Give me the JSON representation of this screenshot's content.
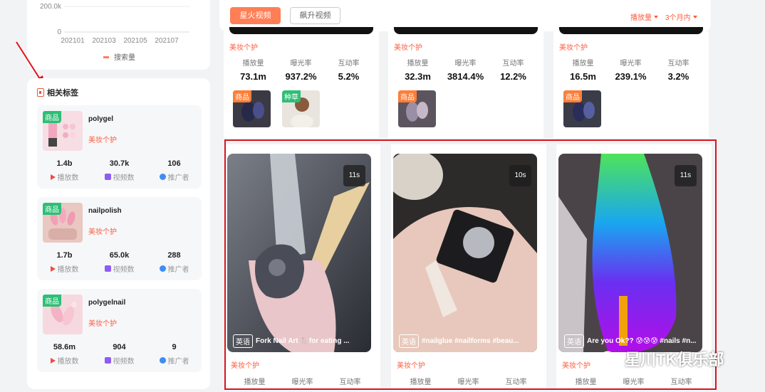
{
  "mini_chart": {
    "y_ticks": [
      "200.0k",
      "0"
    ],
    "x_ticks": [
      "202101",
      "202103",
      "202105",
      "202107"
    ],
    "legend": "搜索量",
    "line_color": "#ff7e55"
  },
  "related_tags": {
    "title": "相关标签",
    "items": [
      {
        "badge": "商品",
        "name": "polygel",
        "category": "美妆个护",
        "stats": [
          {
            "value": "1.4b",
            "label": "播放数"
          },
          {
            "value": "30.7k",
            "label": "视频数"
          },
          {
            "value": "106",
            "label": "推广者"
          }
        ]
      },
      {
        "badge": "商品",
        "name": "nailpolish",
        "category": "美妆个护",
        "stats": [
          {
            "value": "1.7b",
            "label": "播放数"
          },
          {
            "value": "65.0k",
            "label": "视频数"
          },
          {
            "value": "288",
            "label": "推广者"
          }
        ]
      },
      {
        "badge": "商品",
        "name": "polygelnail",
        "category": "美妆个护",
        "stats": [
          {
            "value": "58.6m",
            "label": "播放数"
          },
          {
            "value": "904",
            "label": "视频数"
          },
          {
            "value": "9",
            "label": "推广者"
          }
        ]
      }
    ]
  },
  "toolbar": {
    "hot_video": "星火视频",
    "rising_video": "飙升视频",
    "sort_by": "播放量",
    "period": "3个月内"
  },
  "top_videos": [
    {
      "category": "美妆个护",
      "stats": [
        {
          "label": "播放量",
          "value": "73.1m"
        },
        {
          "label": "曝光率",
          "value": "937.2%"
        },
        {
          "label": "互动率",
          "value": "5.2%"
        }
      ],
      "products": [
        {
          "badge": "商品",
          "badge_color": "#ff7e37"
        },
        {
          "badge": "种草",
          "badge_color": "#2dbf75"
        }
      ]
    },
    {
      "category": "美妆个护",
      "stats": [
        {
          "label": "播放量",
          "value": "32.3m"
        },
        {
          "label": "曝光率",
          "value": "3814.4%"
        },
        {
          "label": "互动率",
          "value": "12.2%"
        }
      ],
      "products": [
        {
          "badge": "商品",
          "badge_color": "#ff7e37"
        }
      ]
    },
    {
      "category": "美妆个护",
      "stats": [
        {
          "label": "播放量",
          "value": "16.5m"
        },
        {
          "label": "曝光率",
          "value": "239.1%"
        },
        {
          "label": "互动率",
          "value": "3.2%"
        }
      ],
      "products": [
        {
          "badge": "商品",
          "badge_color": "#ff7e37"
        }
      ]
    }
  ],
  "videos": [
    {
      "duration": "11s",
      "lang": "英语",
      "caption": "Fork Nail Art 🍴for eating ...",
      "category": "美妆个护",
      "stat_labels": [
        "播放量",
        "曝光率",
        "互动率"
      ]
    },
    {
      "duration": "10s",
      "lang": "英语",
      "caption": "#nailglue #nailforms #beau...",
      "category": "美妆个护",
      "stat_labels": [
        "播放量",
        "曝光率",
        "互动率"
      ]
    },
    {
      "duration": "11s",
      "lang": "英语",
      "caption": "Are you Ok?? 😰😰😰 #nails #n...",
      "category": "美妆个护",
      "stat_labels": [
        "播放量",
        "曝光率",
        "互动率"
      ]
    }
  ],
  "watermark": "星川TK俱乐部",
  "accent_color": "#ff5a3a",
  "highlight_color": "#d7151e"
}
